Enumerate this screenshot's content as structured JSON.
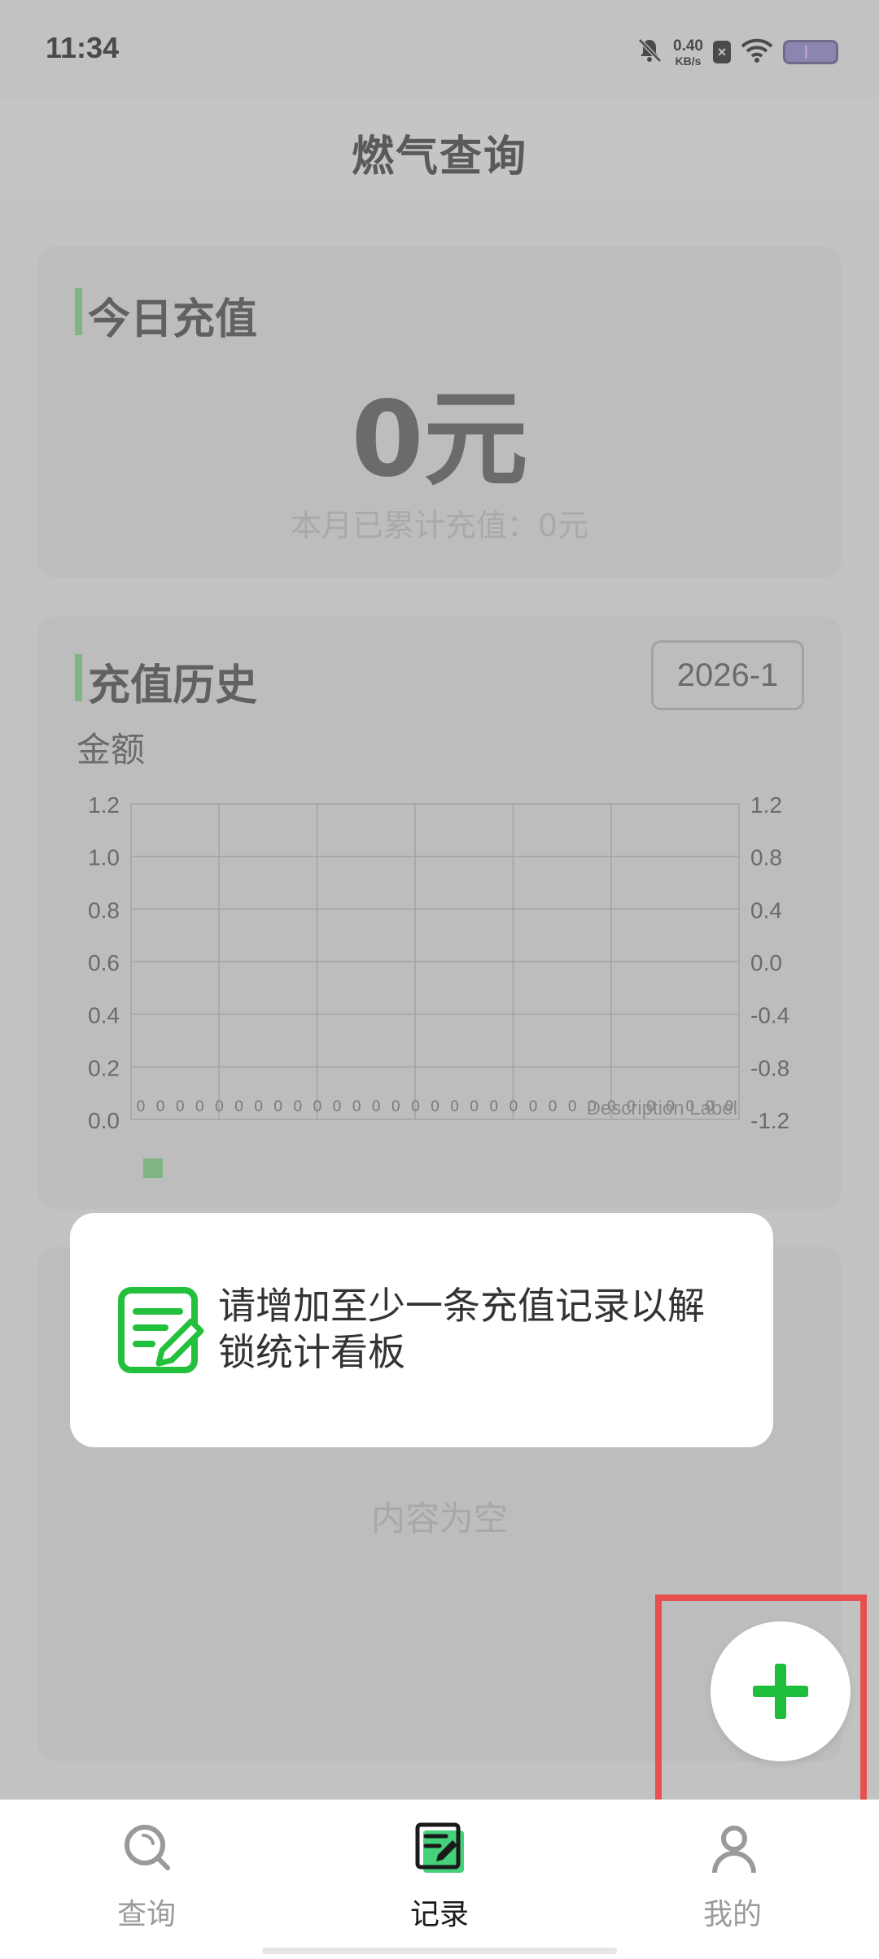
{
  "status_bar": {
    "time": "11:34",
    "net_speed_value": "0.40",
    "net_speed_unit": "KB/s",
    "sim_badge": "×",
    "icons": [
      "bell-off-icon",
      "network-speed-icon",
      "sim-blocked-icon",
      "wifi-icon",
      "battery-icon"
    ]
  },
  "header": {
    "title": "燃气查询"
  },
  "today": {
    "title": "今日充值",
    "amount": "0元",
    "month_total": "本月已累计充值：0元"
  },
  "history": {
    "title": "充值历史",
    "month": "2026-1",
    "amount_label": "金额",
    "description_label": "Description Label"
  },
  "chart_data": {
    "type": "bar",
    "title": "",
    "xlabel": "",
    "ylabel": "金额",
    "y_ticks_left": [
      "1.2",
      "1.0",
      "0.8",
      "0.6",
      "0.4",
      "0.2",
      "0.0"
    ],
    "y_ticks_right": [
      "1.2",
      "0.8",
      "0.4",
      "0.0",
      "-0.4",
      "-0.8",
      "-1.2"
    ],
    "ylim_left": [
      0,
      1.2
    ],
    "ylim_right": [
      -1.2,
      1.2
    ],
    "grid": true,
    "legend_placement": "bottom-left",
    "series": [
      {
        "values": [
          0,
          0,
          0,
          0,
          0,
          0,
          0,
          0,
          0,
          0,
          0,
          0,
          0,
          0,
          0,
          0,
          0,
          0,
          0,
          0,
          0,
          0,
          0,
          0,
          0,
          0,
          0,
          0,
          0,
          0,
          0
        ]
      }
    ],
    "legend_color": "#7fb585"
  },
  "list": {
    "empty_text": "内容为空"
  },
  "toast": {
    "message": "请增加至少一条充值记录以解锁统计看板",
    "icon": "note-edit-icon"
  },
  "fab": {
    "icon": "plus-icon",
    "color": "#1fbe3a"
  },
  "nav": {
    "items": [
      {
        "label": "查询",
        "icon": "search-icon"
      },
      {
        "label": "记录",
        "icon": "record-icon"
      },
      {
        "label": "我的",
        "icon": "user-icon"
      }
    ],
    "active_index": 1
  },
  "colors": {
    "accent": "#7fb585",
    "brand_green": "#1fbe3a",
    "highlight": "#e85050"
  }
}
